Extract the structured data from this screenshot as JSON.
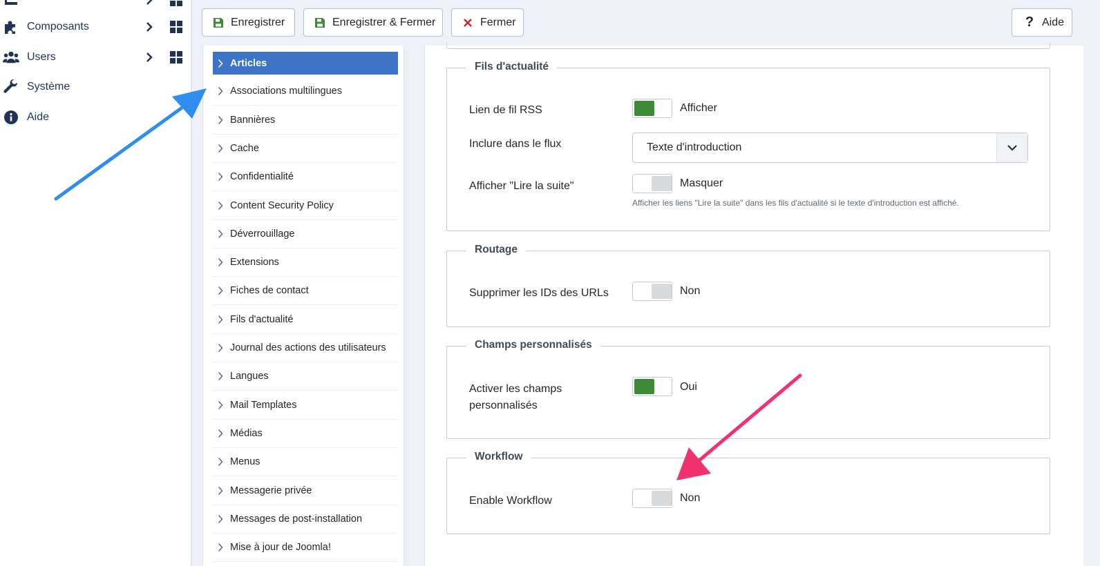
{
  "sidebar": {
    "items": [
      {
        "label": "Composants",
        "icon": "puzzle-icon"
      },
      {
        "label": "Users",
        "icon": "users-icon"
      },
      {
        "label": "Système",
        "icon": "wrench-icon"
      },
      {
        "label": "Aide",
        "icon": "info-icon"
      }
    ]
  },
  "toolbar": {
    "save_label": "Enregistrer",
    "save_close_label": "Enregistrer & Fermer",
    "close_label": "Fermer",
    "help_label": "Aide"
  },
  "tabs": [
    {
      "label": "Articles",
      "active": true
    },
    {
      "label": "Associations multilingues"
    },
    {
      "label": "Bannières"
    },
    {
      "label": "Cache"
    },
    {
      "label": "Confidentialité"
    },
    {
      "label": "Content Security Policy"
    },
    {
      "label": "Déverrouillage"
    },
    {
      "label": "Extensions"
    },
    {
      "label": "Fiches de contact"
    },
    {
      "label": "Fils d'actualité"
    },
    {
      "label": "Journal des actions des utilisateurs"
    },
    {
      "label": "Langues"
    },
    {
      "label": "Mail Templates"
    },
    {
      "label": "Médias"
    },
    {
      "label": "Menus"
    },
    {
      "label": "Messagerie privée"
    },
    {
      "label": "Messages de post-installation"
    },
    {
      "label": "Mise à jour de Joomla!"
    }
  ],
  "sections": {
    "feeds": {
      "legend": "Fils d'actualité",
      "rss_label": "Lien de fil RSS",
      "rss_value": "Afficher",
      "include_label": "Inclure dans le flux",
      "include_value": "Texte d'introduction",
      "readmore_label": "Afficher \"Lire la suite\"",
      "readmore_value": "Masquer",
      "readmore_desc": "Afficher les liens \"Lire la suite\" dans les fils d'actualité si le texte d'introduction est affiché."
    },
    "routing": {
      "legend": "Routage",
      "ids_label": "Supprimer les IDs des URLs",
      "ids_value": "Non"
    },
    "custom_fields": {
      "legend": "Champs personnalisés",
      "enable_label_1": "Activer les champs",
      "enable_label_2": "personnalisés",
      "enable_value": "Oui"
    },
    "workflow": {
      "legend": "Workflow",
      "enable_label": "Enable Workflow",
      "enable_value": "Non"
    }
  },
  "colors": {
    "accent": "#3e74c8",
    "switch_on": "#3d8b37",
    "arrow_blue": "#2f8df0",
    "arrow_pink": "#f0336e"
  }
}
